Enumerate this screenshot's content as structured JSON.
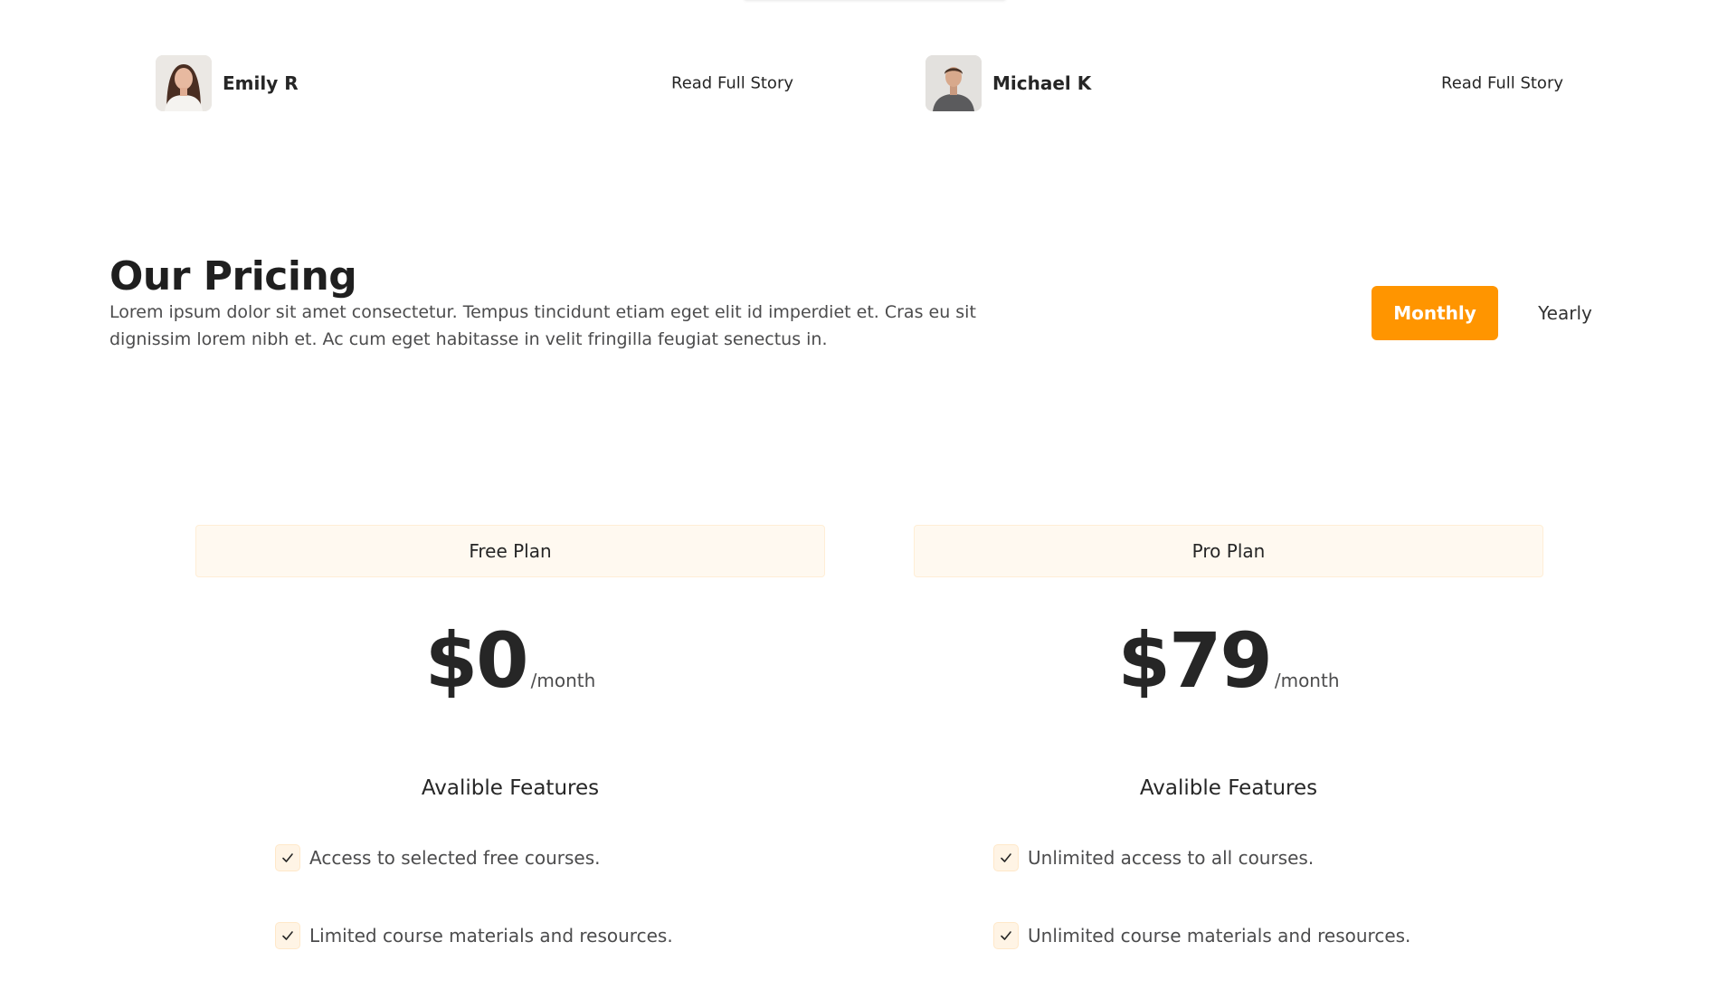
{
  "testimonials": [
    {
      "author": "Emily R",
      "link_label": "Read Full Story",
      "avatar_icon": "woman-portrait"
    },
    {
      "author": "Michael K",
      "link_label": "Read Full Story",
      "avatar_icon": "man-portrait"
    }
  ],
  "pricing": {
    "title": "Our Pricing",
    "description": "Lorem ipsum dolor sit amet consectetur. Tempus tincidunt etiam eget elit id imperdiet et. Cras eu sit dignissim lorem nibh et. Ac cum eget habitasse in velit fringilla feugiat senectus in.",
    "toggle": {
      "monthly_label": "Monthly",
      "yearly_label": "Yearly",
      "selected": "Monthly"
    },
    "plans": [
      {
        "name": "Free Plan",
        "price": "$0",
        "period": "/month",
        "features_title": "Avalible Features",
        "features": [
          "Access to selected free courses.",
          "Limited course materials and resources."
        ]
      },
      {
        "name": "Pro Plan",
        "price": "$79",
        "period": "/month",
        "features_title": "Avalible Features",
        "features": [
          "Unlimited access to all courses.",
          "Unlimited course materials and resources."
        ]
      }
    ]
  },
  "colors": {
    "accent": "#ff9500",
    "plan_header_bg": "#fff9f0",
    "check_bg": "#fff4e5",
    "text_dark": "#262626",
    "text_muted": "#4c4c4d"
  },
  "icons": {
    "check": "check-icon"
  }
}
